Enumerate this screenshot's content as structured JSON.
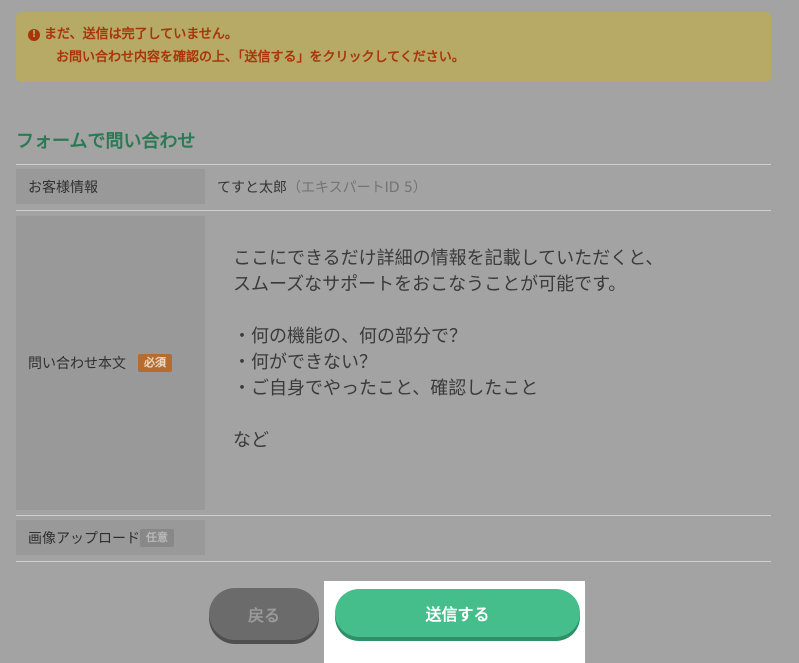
{
  "alert": {
    "icon": "exclamation-circle-icon",
    "line1": "まだ、送信は完了していません。",
    "line2": "お問い合わせ内容を確認の上、「送信する」をクリックしてください。",
    "color": "#a8360a",
    "background": "#b7a966"
  },
  "form": {
    "title": "フォームで問い合わせ",
    "customer": {
      "label": "お客様情報",
      "name": "てすと太郎",
      "expert_id": "（エキスパートID 5）"
    },
    "body": {
      "label": "問い合わせ本文",
      "badge": "必須",
      "placeholder": "ここにできるだけ詳細の情報を記載していただくと、\nスムーズなサポートをおこなうことが可能です。\n\n・何の機能の、何の部分で？\n・何ができない？\n・ご自身でやったこと、確認したこと\n\nなど"
    },
    "image_upload": {
      "label": "画像アップロード",
      "badge": "任意"
    }
  },
  "buttons": {
    "back": "戻る",
    "submit": "送信する",
    "submit_color": "#45be8b"
  }
}
